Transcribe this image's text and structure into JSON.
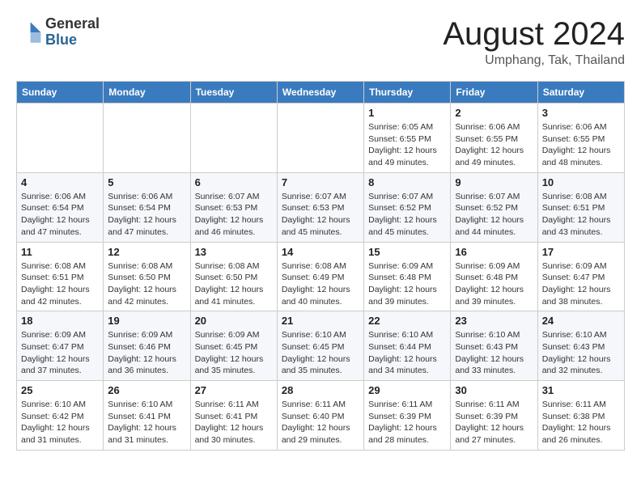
{
  "header": {
    "logo": {
      "line1": "General",
      "line2": "Blue"
    },
    "title": "August 2024",
    "location": "Umphang, Tak, Thailand"
  },
  "weekdays": [
    "Sunday",
    "Monday",
    "Tuesday",
    "Wednesday",
    "Thursday",
    "Friday",
    "Saturday"
  ],
  "weeks": [
    [
      {
        "day": "",
        "info": ""
      },
      {
        "day": "",
        "info": ""
      },
      {
        "day": "",
        "info": ""
      },
      {
        "day": "",
        "info": ""
      },
      {
        "day": "1",
        "info": "Sunrise: 6:05 AM\nSunset: 6:55 PM\nDaylight: 12 hours\nand 49 minutes."
      },
      {
        "day": "2",
        "info": "Sunrise: 6:06 AM\nSunset: 6:55 PM\nDaylight: 12 hours\nand 49 minutes."
      },
      {
        "day": "3",
        "info": "Sunrise: 6:06 AM\nSunset: 6:55 PM\nDaylight: 12 hours\nand 48 minutes."
      }
    ],
    [
      {
        "day": "4",
        "info": "Sunrise: 6:06 AM\nSunset: 6:54 PM\nDaylight: 12 hours\nand 47 minutes."
      },
      {
        "day": "5",
        "info": "Sunrise: 6:06 AM\nSunset: 6:54 PM\nDaylight: 12 hours\nand 47 minutes."
      },
      {
        "day": "6",
        "info": "Sunrise: 6:07 AM\nSunset: 6:53 PM\nDaylight: 12 hours\nand 46 minutes."
      },
      {
        "day": "7",
        "info": "Sunrise: 6:07 AM\nSunset: 6:53 PM\nDaylight: 12 hours\nand 45 minutes."
      },
      {
        "day": "8",
        "info": "Sunrise: 6:07 AM\nSunset: 6:52 PM\nDaylight: 12 hours\nand 45 minutes."
      },
      {
        "day": "9",
        "info": "Sunrise: 6:07 AM\nSunset: 6:52 PM\nDaylight: 12 hours\nand 44 minutes."
      },
      {
        "day": "10",
        "info": "Sunrise: 6:08 AM\nSunset: 6:51 PM\nDaylight: 12 hours\nand 43 minutes."
      }
    ],
    [
      {
        "day": "11",
        "info": "Sunrise: 6:08 AM\nSunset: 6:51 PM\nDaylight: 12 hours\nand 42 minutes."
      },
      {
        "day": "12",
        "info": "Sunrise: 6:08 AM\nSunset: 6:50 PM\nDaylight: 12 hours\nand 42 minutes."
      },
      {
        "day": "13",
        "info": "Sunrise: 6:08 AM\nSunset: 6:50 PM\nDaylight: 12 hours\nand 41 minutes."
      },
      {
        "day": "14",
        "info": "Sunrise: 6:08 AM\nSunset: 6:49 PM\nDaylight: 12 hours\nand 40 minutes."
      },
      {
        "day": "15",
        "info": "Sunrise: 6:09 AM\nSunset: 6:48 PM\nDaylight: 12 hours\nand 39 minutes."
      },
      {
        "day": "16",
        "info": "Sunrise: 6:09 AM\nSunset: 6:48 PM\nDaylight: 12 hours\nand 39 minutes."
      },
      {
        "day": "17",
        "info": "Sunrise: 6:09 AM\nSunset: 6:47 PM\nDaylight: 12 hours\nand 38 minutes."
      }
    ],
    [
      {
        "day": "18",
        "info": "Sunrise: 6:09 AM\nSunset: 6:47 PM\nDaylight: 12 hours\nand 37 minutes."
      },
      {
        "day": "19",
        "info": "Sunrise: 6:09 AM\nSunset: 6:46 PM\nDaylight: 12 hours\nand 36 minutes."
      },
      {
        "day": "20",
        "info": "Sunrise: 6:09 AM\nSunset: 6:45 PM\nDaylight: 12 hours\nand 35 minutes."
      },
      {
        "day": "21",
        "info": "Sunrise: 6:10 AM\nSunset: 6:45 PM\nDaylight: 12 hours\nand 35 minutes."
      },
      {
        "day": "22",
        "info": "Sunrise: 6:10 AM\nSunset: 6:44 PM\nDaylight: 12 hours\nand 34 minutes."
      },
      {
        "day": "23",
        "info": "Sunrise: 6:10 AM\nSunset: 6:43 PM\nDaylight: 12 hours\nand 33 minutes."
      },
      {
        "day": "24",
        "info": "Sunrise: 6:10 AM\nSunset: 6:43 PM\nDaylight: 12 hours\nand 32 minutes."
      }
    ],
    [
      {
        "day": "25",
        "info": "Sunrise: 6:10 AM\nSunset: 6:42 PM\nDaylight: 12 hours\nand 31 minutes."
      },
      {
        "day": "26",
        "info": "Sunrise: 6:10 AM\nSunset: 6:41 PM\nDaylight: 12 hours\nand 31 minutes."
      },
      {
        "day": "27",
        "info": "Sunrise: 6:11 AM\nSunset: 6:41 PM\nDaylight: 12 hours\nand 30 minutes."
      },
      {
        "day": "28",
        "info": "Sunrise: 6:11 AM\nSunset: 6:40 PM\nDaylight: 12 hours\nand 29 minutes."
      },
      {
        "day": "29",
        "info": "Sunrise: 6:11 AM\nSunset: 6:39 PM\nDaylight: 12 hours\nand 28 minutes."
      },
      {
        "day": "30",
        "info": "Sunrise: 6:11 AM\nSunset: 6:39 PM\nDaylight: 12 hours\nand 27 minutes."
      },
      {
        "day": "31",
        "info": "Sunrise: 6:11 AM\nSunset: 6:38 PM\nDaylight: 12 hours\nand 26 minutes."
      }
    ]
  ]
}
